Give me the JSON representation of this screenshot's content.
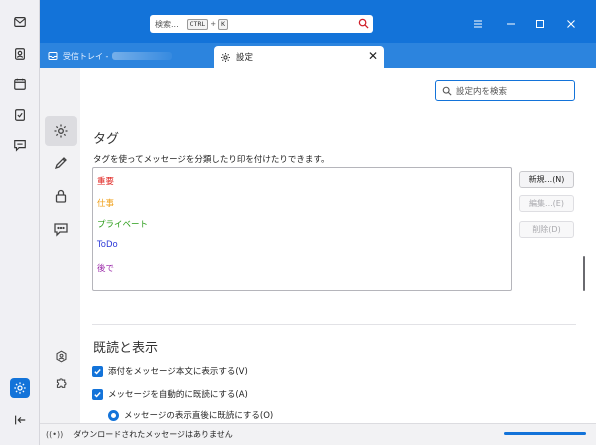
{
  "titlebar": {
    "search_text": "検索...",
    "kbd1": "CTRL",
    "plus": "+",
    "kbd2": "K"
  },
  "tabs": [
    {
      "label": "受信トレイ -"
    },
    {
      "label": "設定"
    }
  ],
  "main": {
    "find_placeholder": "設定内を検索",
    "tags_heading": "タグ",
    "tags_desc": "タグを使ってメッセージを分類したり印を付けたりできます。",
    "tags": [
      {
        "label": "重要",
        "color": "#e0201c"
      },
      {
        "label": "仕事",
        "color": "#f0a019"
      },
      {
        "label": "プライベート",
        "color": "#2a9c18"
      },
      {
        "label": "ToDo",
        "color": "#2b38d8"
      },
      {
        "label": "後で",
        "color": "#9a28a8"
      }
    ],
    "buttons": {
      "new": "新規...(N)",
      "edit": "編集...(E)",
      "delete": "削除(D)"
    },
    "read_heading": "既読と表示",
    "checkbox1": "添付をメッセージ本文に表示する(V)",
    "checkbox2": "メッセージを自動的に既読にする(A)",
    "radio1": "メッセージの表示直後に既読にする(O)"
  },
  "status": {
    "text": "ダウンロードされたメッセージはありません",
    "progress": 1.0
  },
  "colors": {
    "accent": "#1373d9",
    "tabstrip": "#2c84de"
  }
}
